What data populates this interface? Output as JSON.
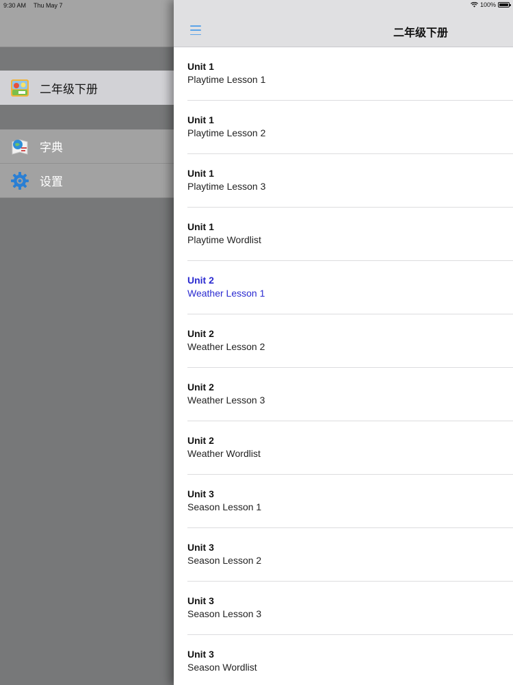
{
  "status_bar": {
    "time": "9:30 AM",
    "date": "Thu May 7",
    "battery": "100%"
  },
  "side_menu": {
    "items": [
      {
        "label": "二年级下册",
        "icon": "book-cover-icon",
        "selected": true
      },
      {
        "label": "字典",
        "icon": "dictionary-icon",
        "selected": false
      },
      {
        "label": "设置",
        "icon": "gear-icon",
        "selected": false
      }
    ]
  },
  "nav_bar": {
    "title": "二年级下册",
    "menu_icon": "hamburger-icon"
  },
  "lessons": [
    {
      "unit": "Unit 1",
      "lesson": "Playtime Lesson 1"
    },
    {
      "unit": "Unit 1",
      "lesson": "Playtime Lesson 2"
    },
    {
      "unit": "Unit 1",
      "lesson": "Playtime Lesson 3"
    },
    {
      "unit": "Unit 1",
      "lesson": "Playtime Wordlist"
    },
    {
      "unit": "Unit 2",
      "lesson": "Weather Lesson 1"
    },
    {
      "unit": "Unit 2",
      "lesson": "Weather Lesson 2"
    },
    {
      "unit": "Unit 2",
      "lesson": "Weather Lesson 3"
    },
    {
      "unit": "Unit 2",
      "lesson": "Weather Wordlist"
    },
    {
      "unit": "Unit 3",
      "lesson": "Season Lesson 1"
    },
    {
      "unit": "Unit 3",
      "lesson": "Season Lesson 2"
    },
    {
      "unit": "Unit 3",
      "lesson": "Season Lesson 3"
    },
    {
      "unit": "Unit 3",
      "lesson": "Season Wordlist"
    }
  ],
  "colors": {
    "accent": "#5aa3e8",
    "active_row_text": "#2a2ad0"
  }
}
